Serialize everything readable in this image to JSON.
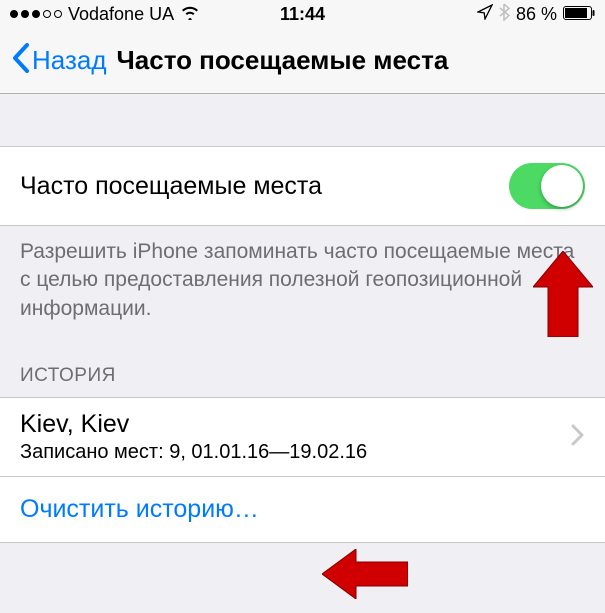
{
  "status": {
    "carrier": "Vodafone UA",
    "time": "11:44",
    "battery_pct": "86 %"
  },
  "nav": {
    "back": "Назад",
    "title": "Часто посещаемые места"
  },
  "toggle_row": {
    "label": "Часто посещаемые места",
    "on": true
  },
  "footer": "Разрешить iPhone запоминать часто посещаемые места с целью предоставления полезной геопозиционной информации.",
  "history": {
    "header": "ИСТОРИЯ",
    "items": [
      {
        "title": "Kiev, Kiev",
        "sub": "Записано мест: 9, 01.01.16—19.02.16"
      }
    ],
    "clear_action": "Очистить историю…"
  }
}
